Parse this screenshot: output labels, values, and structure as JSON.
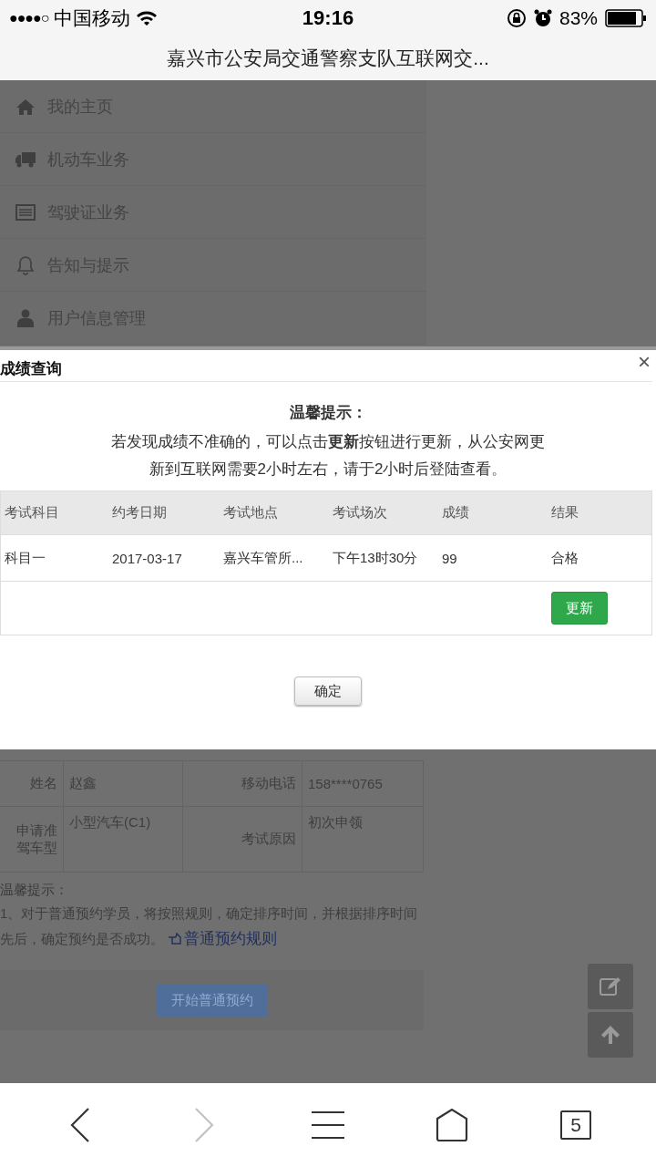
{
  "status_bar": {
    "signal": "●●●●○",
    "carrier": "中国移动",
    "time": "19:16",
    "battery": "83%"
  },
  "page_title": "嘉兴市公安局交通警察支队互联网交...",
  "side_menu": [
    {
      "label": "我的主页"
    },
    {
      "label": "机动车业务"
    },
    {
      "label": "驾驶证业务"
    },
    {
      "label": "告知与提示"
    },
    {
      "label": "用户信息管理"
    }
  ],
  "dialog": {
    "title": "成绩查询",
    "close": "×",
    "notice_title": "温馨提示：",
    "notice_text": "若发现成绩不准确的，可以点击**更新**按钮进行更新，从公安网更新到互联网需要2小时左右，请于2小时后登陆查看。",
    "columns": [
      "考试科目",
      "约考日期",
      "考试地点",
      "考试场次",
      "成绩",
      "结果"
    ],
    "rows": [
      [
        "科目一",
        "2017-03-17",
        "嘉兴车管所...",
        "下午13时30分",
        "99",
        "合格"
      ]
    ],
    "update_button": "更新",
    "ok_button": "确定"
  },
  "background": {
    "info_rows": [
      {
        "label": "姓名",
        "value": "赵鑫",
        "label_2": "移动电话",
        "value_2": "158****0765"
      },
      {
        "label": "申请准驾车型",
        "value": "小型汽车(C1)",
        "label_2": "考试原因",
        "value_2": "初次申领"
      }
    ],
    "tips_title": "温馨提示：",
    "tips_text": "1、对于普通预约学员，将按照规则，确定排序时间，并根据排序时间先后，确定预约是否成功。",
    "rules_link": "普通预约规则",
    "start_button": "开始普通预约"
  },
  "bottom_toolbar": [
    {
      "kind": "back",
      "disabled": false
    },
    {
      "kind": "forward",
      "disabled": true
    },
    {
      "kind": "menu",
      "disabled": false
    },
    {
      "kind": "home",
      "disabled": false
    },
    {
      "kind": "tabs",
      "disabled": false,
      "count": "5"
    }
  ]
}
